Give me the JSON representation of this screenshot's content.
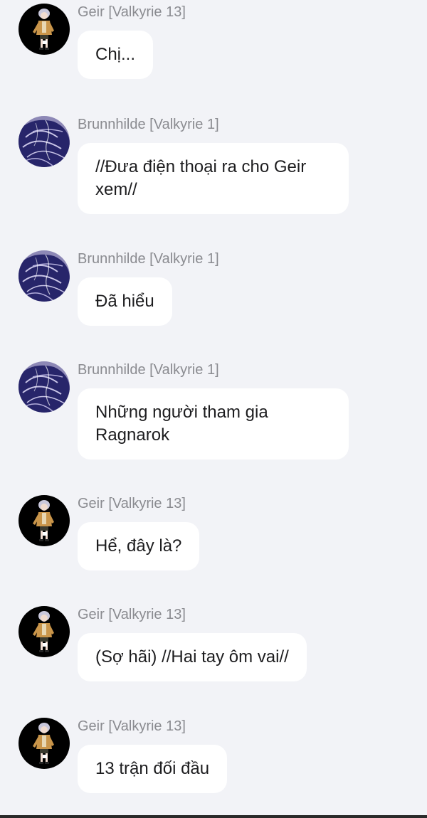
{
  "messages": [
    {
      "sender": "Geir [Valkyrie 13]",
      "text": "Chị...",
      "avatar": "geir-avatar-icon"
    },
    {
      "sender": "Brunnhilde [Valkyrie 1]",
      "text": "//Đưa điện thoại ra cho Geir xem//",
      "avatar": "brunnhilde-avatar-icon"
    },
    {
      "sender": "Brunnhilde [Valkyrie 1]",
      "text": "Đã hiểu",
      "avatar": "brunnhilde-avatar-icon"
    },
    {
      "sender": "Brunnhilde [Valkyrie 1]",
      "text": "Những người tham gia Ragnarok",
      "avatar": "brunnhilde-avatar-icon"
    },
    {
      "sender": "Geir [Valkyrie 13]",
      "text": "Hể, đây là?",
      "avatar": "geir-avatar-icon"
    },
    {
      "sender": "Geir [Valkyrie 13]",
      "text": "(Sợ hãi) //Hai tay ôm vai//",
      "avatar": "geir-avatar-icon"
    },
    {
      "sender": "Geir [Valkyrie 13]",
      "text": "13 trận đối đầu",
      "avatar": "geir-avatar-icon"
    }
  ],
  "colors": {
    "background": "#f2f3f7",
    "bubble": "#ffffff",
    "sender_text": "#8a8b90",
    "message_text": "#1d1d1f",
    "brunnhilde_avatar": "#2b2a6e",
    "geir_avatar": "#000000"
  }
}
